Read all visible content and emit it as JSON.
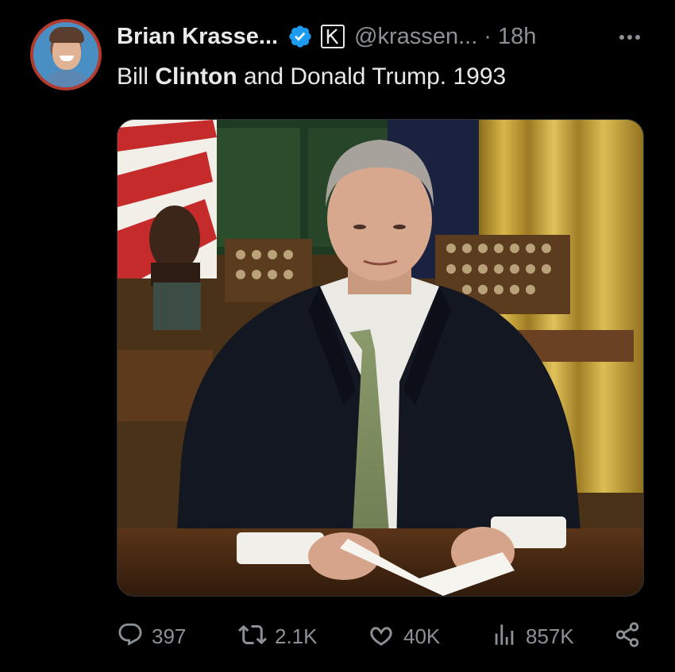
{
  "author": {
    "display_name": "Brian Krasse...",
    "handle": "@krassen...",
    "separator": "·",
    "time": "18h",
    "verified": true,
    "affiliate_badge_letter": "K"
  },
  "tweet": {
    "text_before": "Bill ",
    "text_bold": "Clinton",
    "text_after": " and Donald Trump. 1993"
  },
  "media": {
    "description_icon": "photo-oval-office"
  },
  "actions": {
    "replies": "397",
    "reposts": "2.1K",
    "likes": "40K",
    "views": "857K"
  },
  "icons": {
    "verified": "verified-check-icon",
    "more": "more-horizontal-icon",
    "reply": "reply-bubble-icon",
    "repost": "repost-icon",
    "like": "heart-icon",
    "views": "bar-chart-icon",
    "share": "share-icon"
  },
  "colors": {
    "background": "#000000",
    "text": "#e7e9ea",
    "muted": "#8b9197",
    "verified_blue": "#1d9bf0",
    "avatar_ring": "#b33a2e"
  }
}
